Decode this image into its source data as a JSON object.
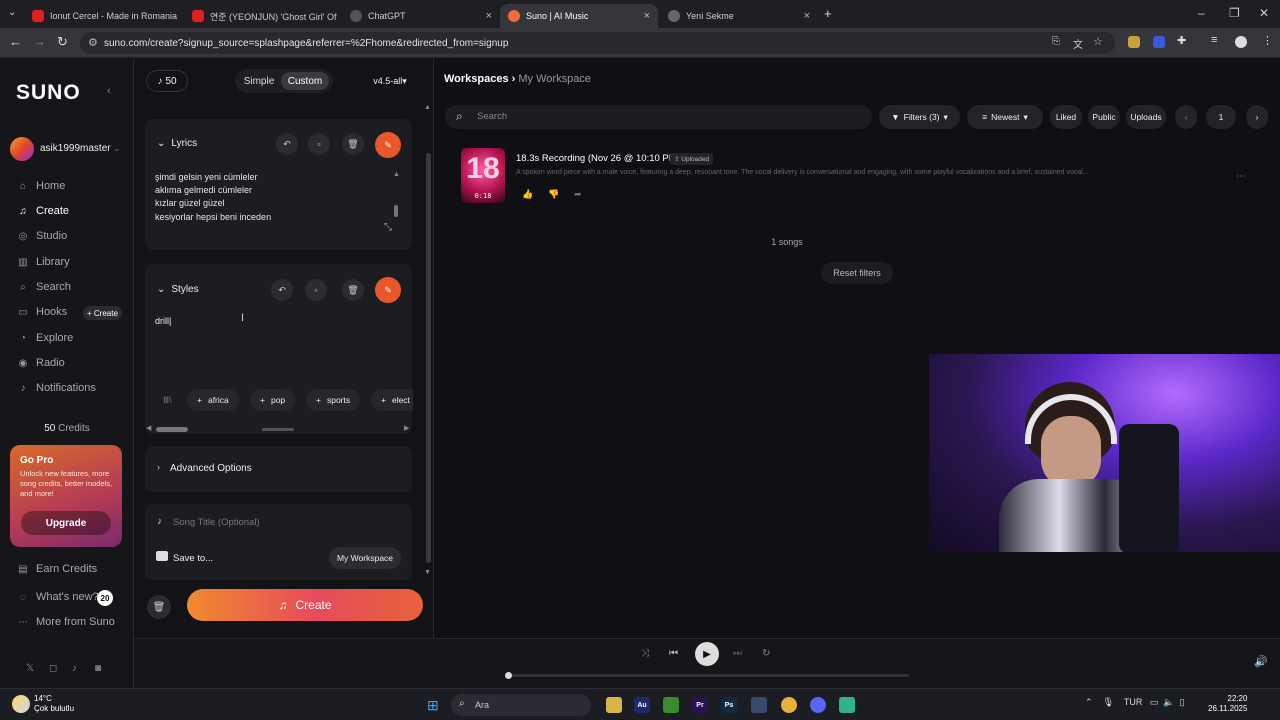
{
  "browser": {
    "tabs": [
      {
        "title": "Ionut Cercel - Made in Romania",
        "color": "#e02020"
      },
      {
        "title": "연준 (YEONJUN) 'Ghost Girl' Of",
        "color": "#e02020"
      },
      {
        "title": "ChatGPT",
        "color": "#888888"
      },
      {
        "title": "Suno | AI Music",
        "color": "#f06a3a"
      },
      {
        "title": "Yeni Sekme",
        "color": "#888888"
      }
    ],
    "url": "suno.com/create?signup_source=splashpage&referrer=%2Fhome&redirected_from=signup"
  },
  "sidebar": {
    "logo": "SUNO",
    "username": "asik1999master",
    "items": [
      {
        "label": "Home",
        "icon": "home-icon"
      },
      {
        "label": "Create",
        "icon": "music-note-icon"
      },
      {
        "label": "Studio",
        "icon": "studio-icon"
      },
      {
        "label": "Library",
        "icon": "library-icon"
      },
      {
        "label": "Search",
        "icon": "search-icon"
      },
      {
        "label": "Hooks",
        "icon": "hooks-icon"
      },
      {
        "label": "Explore",
        "icon": "explore-icon"
      },
      {
        "label": "Radio",
        "icon": "radio-icon"
      },
      {
        "label": "Notifications",
        "icon": "bell-icon"
      }
    ],
    "hooks_create": "+ Create",
    "credits_count": "50",
    "credits_label": "Credits",
    "gopro": {
      "title": "Go Pro",
      "desc": "Unlock new features, more song credits, better models, and more!",
      "button": "Upgrade"
    },
    "bottom": {
      "earn": "Earn Credits",
      "whatsnew": "What's new?",
      "whatsnew_badge": "20",
      "more": "More from Suno"
    }
  },
  "panel": {
    "credits": "50",
    "mode_simple": "Simple",
    "mode_custom": "Custom",
    "model": "v4.5-all",
    "lyrics": {
      "title": "Lyrics",
      "lines": [
        "şimdi gelsin yeni cümleler",
        "aklıma gelmedi cümleler",
        "kızlar güzel güzel",
        "kesiyorlar hepsi beni inceden"
      ]
    },
    "styles": {
      "title": "Styles",
      "value": "drill",
      "tags": [
        "africa",
        "pop",
        "sports",
        "elect"
      ]
    },
    "advanced": "Advanced Options",
    "song_title_placeholder": "Song Title (Optional)",
    "save_to": "Save to...",
    "workspace_pill": "My Workspace",
    "create": "Create"
  },
  "main": {
    "crumb_root": "Workspaces",
    "crumb_current": "My Workspace",
    "search_placeholder": "Search",
    "filters": "Filters (3)",
    "sort": "Newest",
    "liked": "Liked",
    "public": "Public",
    "uploads": "Uploads",
    "page": "1",
    "song": {
      "thumb_number": "18",
      "duration": "0:18",
      "title": "18.3s Recording (Nov 26 @ 10:10 PM)",
      "badge": "Uploaded",
      "desc": "A spoken word piece with a male voice, featuring a deep, resonant tone. The vocal delivery is conversational and engaging, with some playful vocalizations and a brief, sustained vocal..."
    },
    "count": "1 songs",
    "reset": "Reset filters"
  },
  "taskbar": {
    "temp": "14°C",
    "weather": "Çok bulutlu",
    "search": "Ara",
    "lang": "TUR",
    "time": "22:20",
    "date": "26.11.2025"
  }
}
